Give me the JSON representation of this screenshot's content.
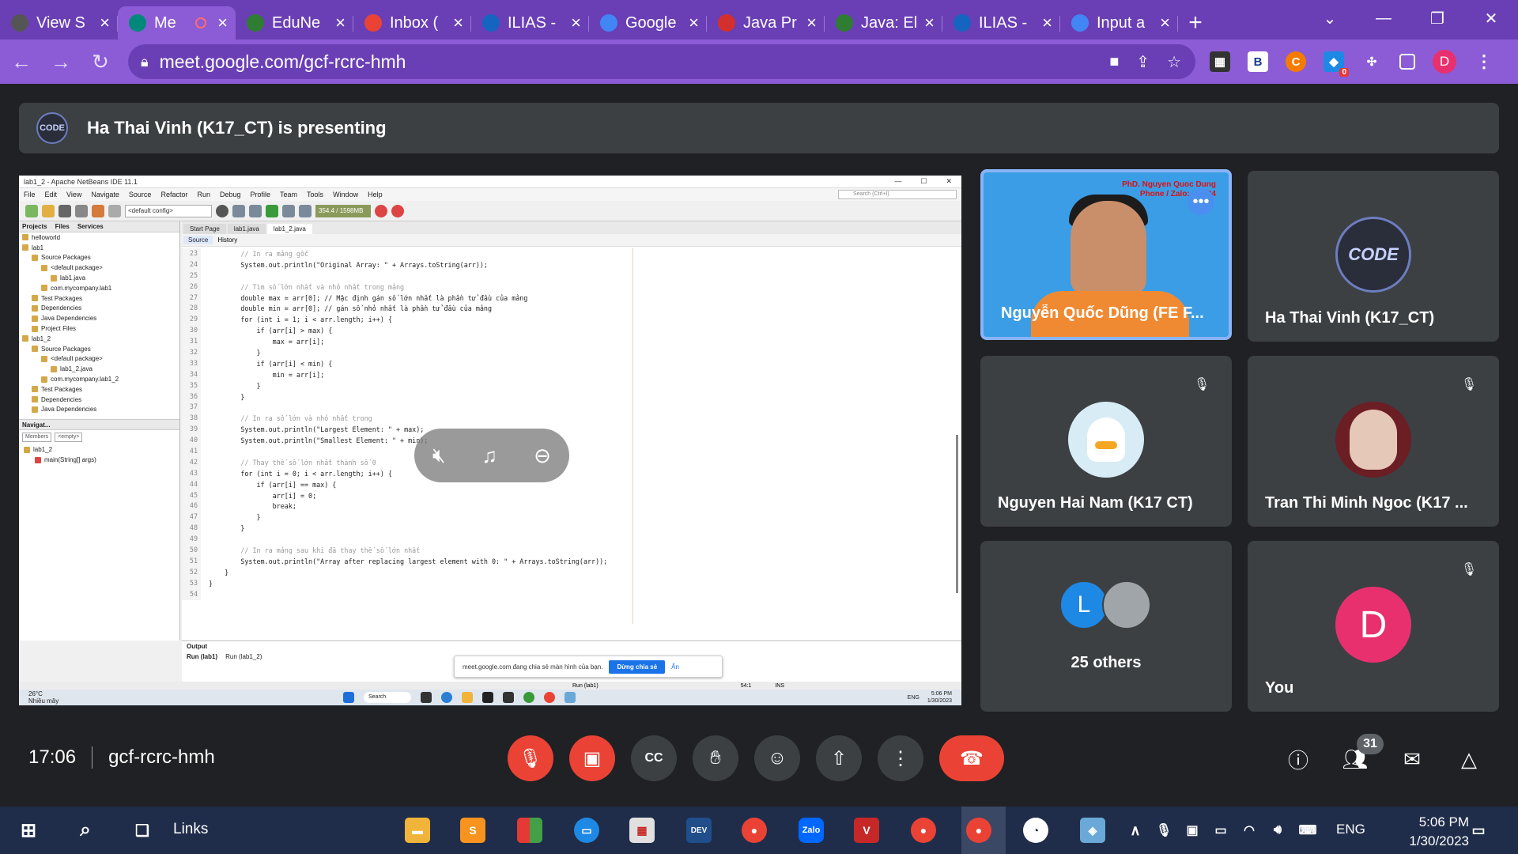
{
  "browser": {
    "tabs": [
      {
        "label": "View S",
        "color": "#555"
      },
      {
        "label": "Me",
        "color": "#00897b",
        "active": true
      },
      {
        "label": "EduNe",
        "color": "#2e7d32"
      },
      {
        "label": "Inbox (",
        "color": "#ea4335"
      },
      {
        "label": "ILIAS -",
        "color": "#1565c0"
      },
      {
        "label": "Google",
        "color": "#4285f4"
      },
      {
        "label": "Java Pr",
        "color": "#d32f2f"
      },
      {
        "label": "Java: El",
        "color": "#2e7d32"
      },
      {
        "label": "ILIAS -",
        "color": "#1565c0"
      },
      {
        "label": "Input a",
        "color": "#4285f4"
      }
    ],
    "url": "meet.google.com/gcf-rcrc-hmh",
    "profile_initial": "D",
    "ext_badge": "0"
  },
  "meet": {
    "presenting_text": "Ha Thai Vinh (K17_CT) is presenting",
    "presenter_logo": "CODE",
    "time": "17:06",
    "meeting_code": "gcf-rcrc-hmh",
    "participants_count": "31",
    "tiles": {
      "speaker": {
        "name": "Nguyễn Quốc Dũng (FE F...",
        "banner": "PhD. Nguyen Quoc Dung\nPhone / Zalo: 0 ... 94"
      },
      "vinh": {
        "name": "Ha Thai Vinh (K17_CT)",
        "logo": "CODE"
      },
      "nam": {
        "name": "Nguyen Hai Nam (K17 CT)"
      },
      "ngoc": {
        "name": "Tran Thi Minh Ngoc (K17 ..."
      },
      "others": {
        "label": "25 others",
        "initial": "L"
      },
      "you": {
        "label": "You",
        "initial": "D"
      }
    }
  },
  "netbeans": {
    "title": "lab1_2 - Apache NetBeans IDE 11.1",
    "menu": [
      "File",
      "Edit",
      "View",
      "Navigate",
      "Source",
      "Refactor",
      "Run",
      "Debug",
      "Profile",
      "Team",
      "Tools",
      "Window",
      "Help"
    ],
    "search_placeholder": "Search (Ctrl+I)",
    "config": "<default config>",
    "memory": "354.4 / 1598MB",
    "panel_tabs": [
      "Projects",
      "Files",
      "Services"
    ],
    "tree": [
      "helloworld",
      "lab1",
      "Source Packages",
      "<default package>",
      "lab1.java",
      "com.mycompany.lab1",
      "Test Packages",
      "Dependencies",
      "Java Dependencies",
      "Project Files",
      "lab1_2",
      "Source Packages",
      "<default package>",
      "lab1_2.java",
      "com.mycompany.lab1_2",
      "Test Packages",
      "Dependencies",
      "Java Dependencies"
    ],
    "navigator_title": "Navigat...",
    "navigator_combo": "Members",
    "navigator_empty": "<empty>",
    "navigator_items": [
      "lab1_2",
      "main(String[] args)"
    ],
    "editor_tabs": [
      "Start Page",
      "lab1.java",
      "lab1_2.java"
    ],
    "editor_modes": [
      "Source",
      "History"
    ],
    "code_lines": [
      {
        "n": "23",
        "t": "        // In ra mảng gốc"
      },
      {
        "n": "24",
        "t": "        System.out.println(\"Original Array: \" + Arrays.toString(arr));"
      },
      {
        "n": "25",
        "t": ""
      },
      {
        "n": "26",
        "t": "        // Tìm số lớn nhất và nhỏ nhất trong mảng"
      },
      {
        "n": "27",
        "t": "        double max = arr[0]; // Mặc định gán số lớn nhất là phần tử đầu của mảng"
      },
      {
        "n": "28",
        "t": "        double min = arr[0]; // gán số nhỏ nhất là phần tử đầu của mảng"
      },
      {
        "n": "29",
        "t": "        for (int i = 1; i < arr.length; i++) {"
      },
      {
        "n": "30",
        "t": "            if (arr[i] > max) {"
      },
      {
        "n": "31",
        "t": "                max = arr[i];"
      },
      {
        "n": "32",
        "t": "            }"
      },
      {
        "n": "33",
        "t": "            if (arr[i] < min) {"
      },
      {
        "n": "34",
        "t": "                min = arr[i];"
      },
      {
        "n": "35",
        "t": "            }"
      },
      {
        "n": "36",
        "t": "        }"
      },
      {
        "n": "37",
        "t": ""
      },
      {
        "n": "38",
        "t": "        // In ra số lớn và nhỏ nhất trong"
      },
      {
        "n": "39",
        "t": "        System.out.println(\"Largest Element: \" + max);"
      },
      {
        "n": "40",
        "t": "        System.out.println(\"Smallest Element: \" + min);"
      },
      {
        "n": "41",
        "t": ""
      },
      {
        "n": "42",
        "t": "        // Thay thế số lớn nhất thành số 0"
      },
      {
        "n": "43",
        "t": "        for (int i = 0; i < arr.length; i++) {"
      },
      {
        "n": "44",
        "t": "            if (arr[i] == max) {"
      },
      {
        "n": "45",
        "t": "                arr[i] = 0;"
      },
      {
        "n": "46",
        "t": "                break;"
      },
      {
        "n": "47",
        "t": "            }"
      },
      {
        "n": "48",
        "t": "        }"
      },
      {
        "n": "49",
        "t": ""
      },
      {
        "n": "50",
        "t": "        // In ra mảng sau khi đã thay thế số lớn nhất"
      },
      {
        "n": "51",
        "t": "        System.out.println(\"Array after replacing largest element with 0: \" + Arrays.toString(arr));"
      },
      {
        "n": "52",
        "t": "    }"
      },
      {
        "n": "53",
        "t": "}"
      },
      {
        "n": "54",
        "t": ""
      }
    ],
    "output_title": "Output",
    "output_tabs": [
      "Run (lab1)",
      "Run (lab1_2)"
    ],
    "share_notice": "meet.google.com đang chia sẻ màn hình của bạn.",
    "share_stop": "Dừng chia sẻ",
    "share_hide": "Ẩn",
    "status_run": "Run (lab1)",
    "status_pos": "54:1",
    "status_ins": "INS",
    "inner_taskbar": {
      "temp": "26°C",
      "weather": "Nhiều mây",
      "search": "Search",
      "lang": "ENG",
      "time": "5:06 PM",
      "date": "1/30/2023"
    }
  },
  "taskbar": {
    "links_label": "Links",
    "lang": "ENG",
    "time": "5:06 PM",
    "date": "1/30/2023",
    "dev_label": "DEV"
  }
}
